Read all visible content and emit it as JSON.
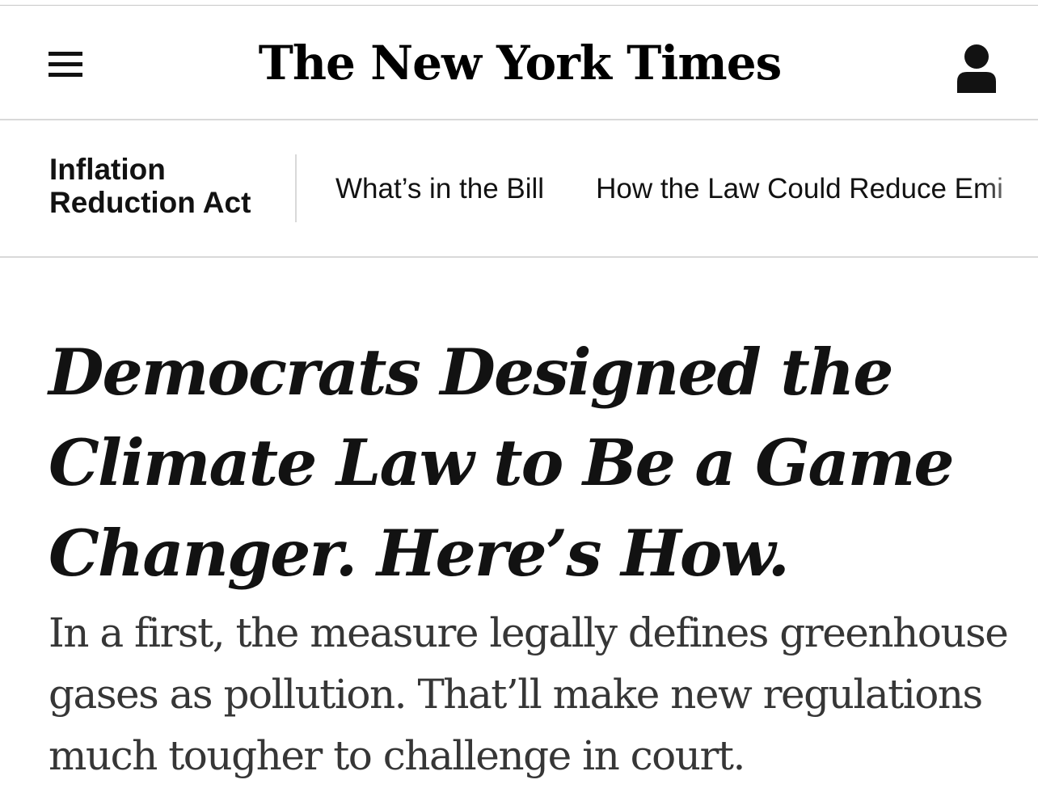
{
  "masthead": {
    "logo_text": "The New York Times",
    "menu_icon": "hamburger-menu-icon",
    "account_icon": "person-icon"
  },
  "section_nav": {
    "title": "Inflation Reduction Act",
    "links": [
      {
        "label": "What’s in the Bill"
      },
      {
        "label": "How the Law Could Reduce Emi"
      }
    ]
  },
  "article": {
    "headline": "Democrats Designed the Climate Law to Be a Game Changer. Here’s How.",
    "summary": "In a first, the measure legally defines greenhouse gases as pollution. That’ll make new regulations much tougher to challenge in court."
  },
  "colors": {
    "text_primary": "#121212",
    "text_secondary": "#363636",
    "divider": "#d9d9d9",
    "background": "#ffffff"
  }
}
